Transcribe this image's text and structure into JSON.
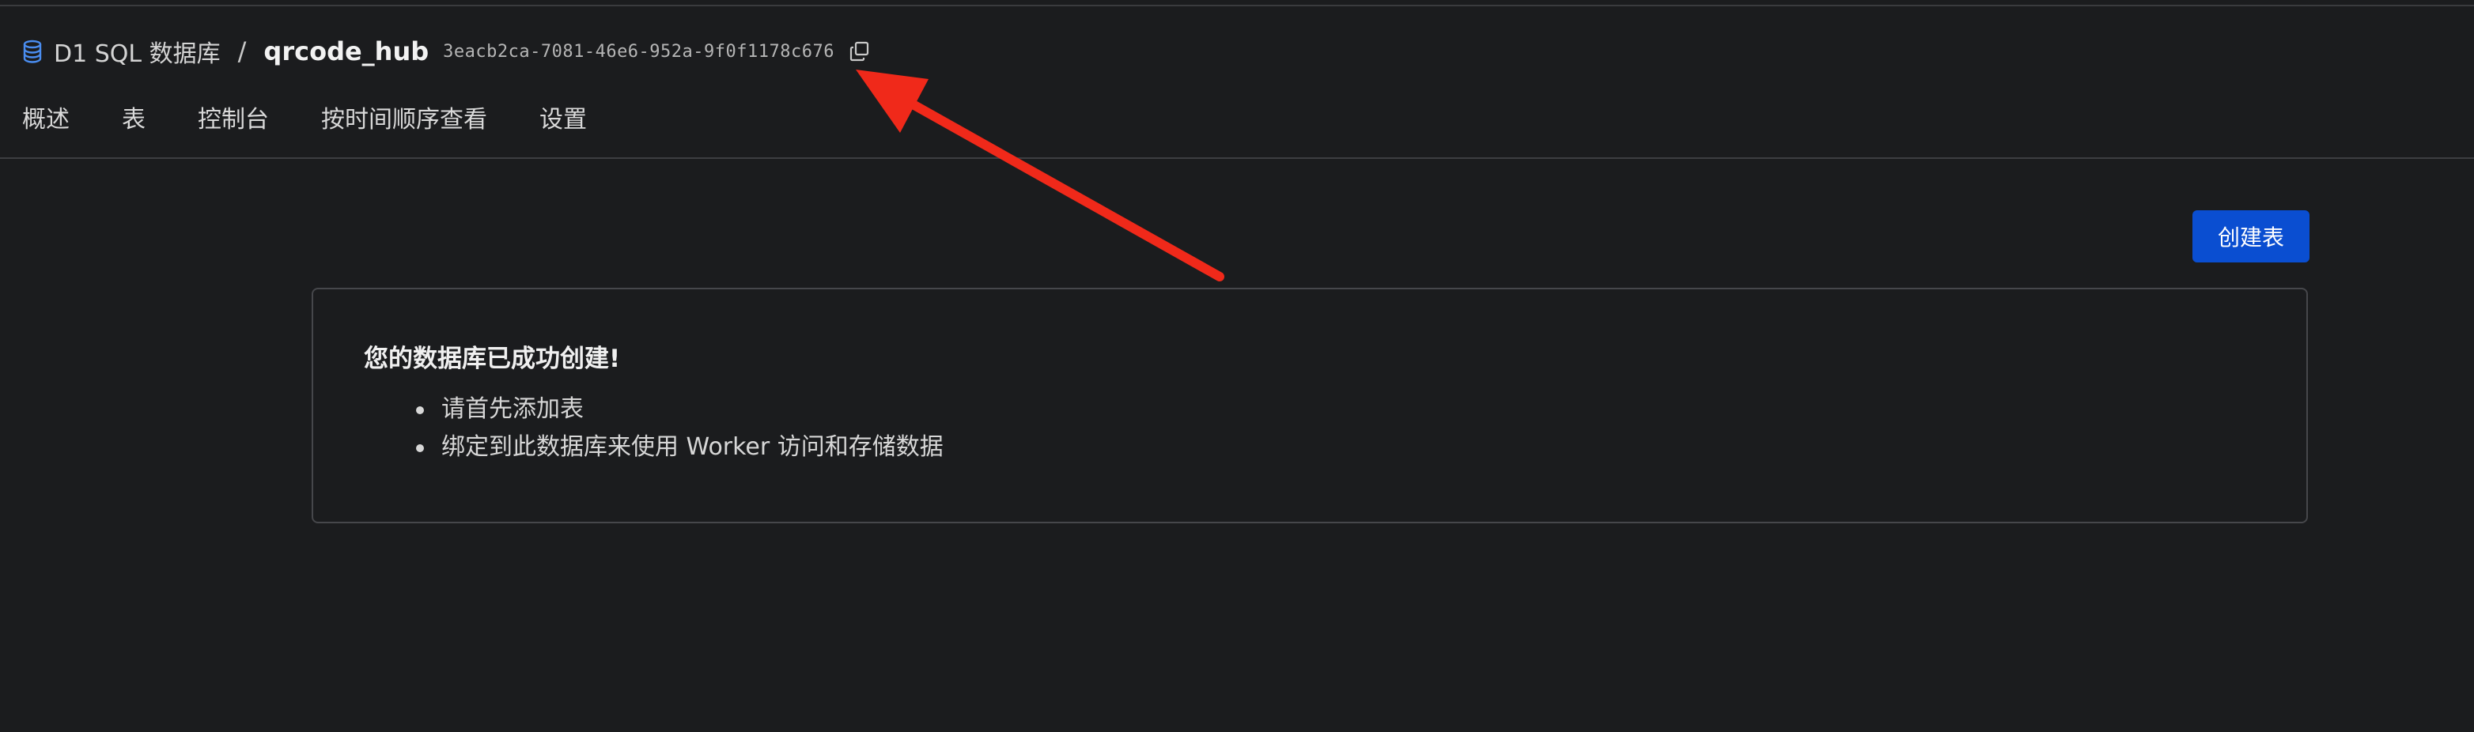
{
  "breadcrumb": {
    "root_label": "D1 SQL 数据库",
    "separator": "/",
    "database_name": "qrcode_hub",
    "database_id": "3eacb2ca-7081-46e6-952a-9f0f1178c676"
  },
  "tabs": [
    {
      "label": "概述"
    },
    {
      "label": "表"
    },
    {
      "label": "控制台"
    },
    {
      "label": "按时间顺序查看"
    },
    {
      "label": "设置"
    }
  ],
  "toolbar": {
    "create_table_label": "创建表"
  },
  "card": {
    "title": "您的数据库已成功创建!",
    "items": [
      "请首先添加表",
      "绑定到此数据库来使用 Worker 访问和存储数据"
    ]
  },
  "icons": {
    "database": "database-icon",
    "copy": "copy-icon"
  },
  "colors": {
    "background": "#1b1c1e",
    "accent_button": "#0a4ed1",
    "database_icon": "#4a8df0",
    "annotation_arrow": "#f0291a"
  }
}
